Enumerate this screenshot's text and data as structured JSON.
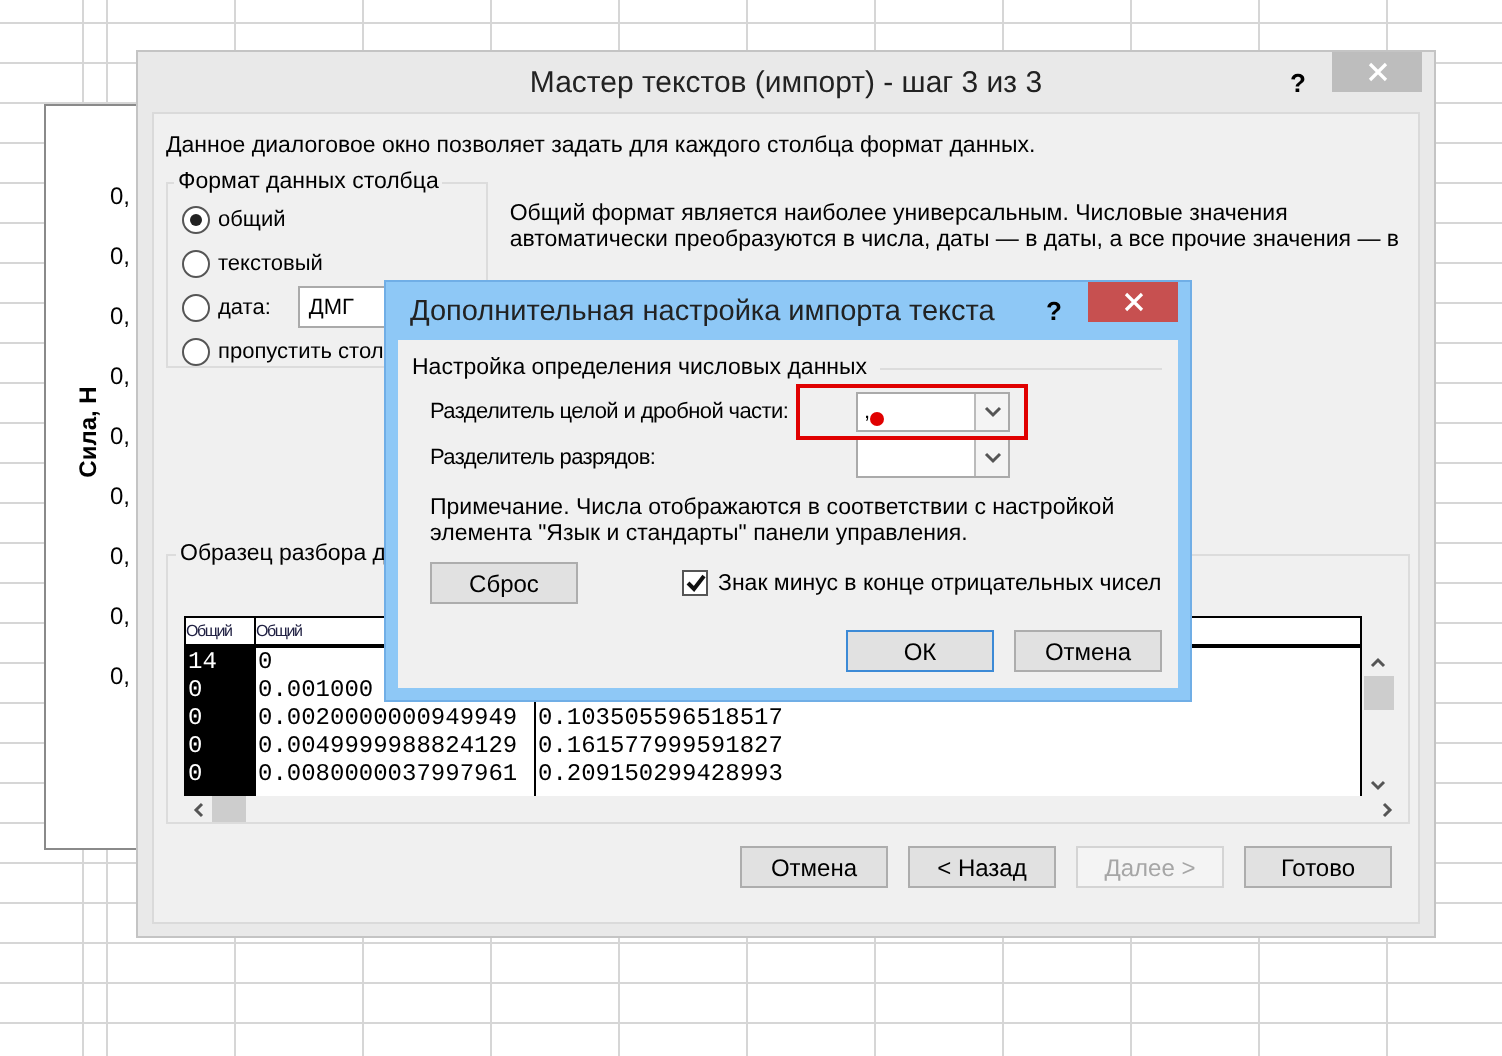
{
  "spreadsheet": {
    "chart": {
      "axis_title": "Сила, Н",
      "tick_labels": [
        "0,",
        "0,",
        "0,",
        "0,",
        "0,",
        "0,",
        "0,",
        "0,",
        "0,"
      ]
    }
  },
  "wizard": {
    "title": "Мастер текстов (импорт) - шаг 3 из 3",
    "help": "?",
    "intro": "Данное диалоговое окно позволяет задать для каждого столбца формат данных.",
    "format_group": {
      "title": "Формат данных столбца",
      "options": [
        {
          "kind": "plain",
          "label": "общий",
          "selected": true
        },
        {
          "kind": "plain",
          "label": "текстовый",
          "selected": false
        },
        {
          "kind": "date",
          "label": "дата:",
          "selected": false,
          "value": "ДМГ"
        },
        {
          "kind": "plain",
          "label": "пропустить стол",
          "selected": false
        }
      ]
    },
    "description": "Общий формат является наиболее универсальным. Числовые значения автоматически преобразуются в числа, даты — в даты, а все прочие значения — в",
    "preview": {
      "title": "Образец разбора д",
      "columns": [
        {
          "header": "Общий",
          "selected": true
        },
        {
          "header": "Общий",
          "selected": false
        },
        {
          "selected": false
        }
      ],
      "rows": [
        [
          "14",
          "0"
        ],
        [
          "0",
          "0.001000"
        ],
        [
          "0",
          "0.0020000000949949",
          "0.103505596518517"
        ],
        [
          "0",
          "0.0049999988824129",
          "0.161577999591827"
        ],
        [
          "0",
          "0.0080000037997961",
          "0.209150299428993"
        ]
      ]
    },
    "buttons": [
      {
        "label": "Отмена",
        "disabled": false
      },
      {
        "label": "< Назад",
        "disabled": false
      },
      {
        "label": "Далее >",
        "disabled": true
      },
      {
        "label": "Готово",
        "disabled": false
      }
    ]
  },
  "options_dialog": {
    "title": "Дополнительная настройка импорта текста",
    "help": "?",
    "group_title": "Настройка определения числовых данных",
    "fields": [
      {
        "label": "Разделитель целой и дробной части:",
        "value": ","
      },
      {
        "label": "Разделитель разрядов:"
      }
    ],
    "note": "Примечание. Числа отображаются в соответствии с настройкой элемента \"Язык и стандарты\" панели управления.",
    "reset_button": "Сброс",
    "trailing_minus": {
      "label": "Знак минус в конце отрицательных чисел",
      "checked": true
    },
    "buttons": [
      {
        "label": "ОК",
        "default": true
      },
      {
        "label": "Отмена",
        "default": false
      }
    ]
  }
}
